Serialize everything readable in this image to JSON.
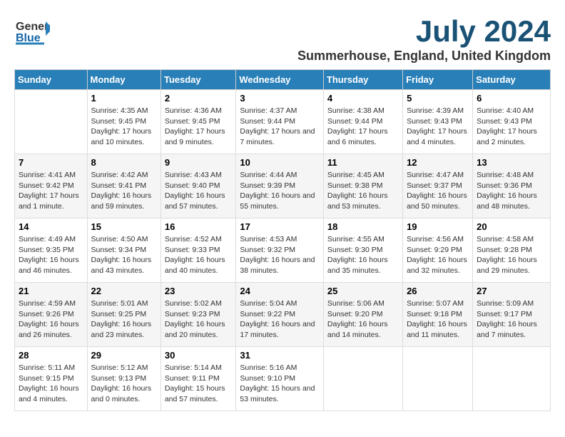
{
  "header": {
    "logo_general": "General",
    "logo_blue": "Blue",
    "title": "July 2024",
    "subtitle": "Summerhouse, England, United Kingdom"
  },
  "calendar": {
    "days": [
      "Sunday",
      "Monday",
      "Tuesday",
      "Wednesday",
      "Thursday",
      "Friday",
      "Saturday"
    ],
    "weeks": [
      [
        {
          "date": "",
          "content": ""
        },
        {
          "date": "1",
          "content": "Sunrise: 4:35 AM\nSunset: 9:45 PM\nDaylight: 17 hours\nand 10 minutes."
        },
        {
          "date": "2",
          "content": "Sunrise: 4:36 AM\nSunset: 9:45 PM\nDaylight: 17 hours\nand 9 minutes."
        },
        {
          "date": "3",
          "content": "Sunrise: 4:37 AM\nSunset: 9:44 PM\nDaylight: 17 hours\nand 7 minutes."
        },
        {
          "date": "4",
          "content": "Sunrise: 4:38 AM\nSunset: 9:44 PM\nDaylight: 17 hours\nand 6 minutes."
        },
        {
          "date": "5",
          "content": "Sunrise: 4:39 AM\nSunset: 9:43 PM\nDaylight: 17 hours\nand 4 minutes."
        },
        {
          "date": "6",
          "content": "Sunrise: 4:40 AM\nSunset: 9:43 PM\nDaylight: 17 hours\nand 2 minutes."
        }
      ],
      [
        {
          "date": "7",
          "content": "Sunrise: 4:41 AM\nSunset: 9:42 PM\nDaylight: 17 hours\nand 1 minute."
        },
        {
          "date": "8",
          "content": "Sunrise: 4:42 AM\nSunset: 9:41 PM\nDaylight: 16 hours\nand 59 minutes."
        },
        {
          "date": "9",
          "content": "Sunrise: 4:43 AM\nSunset: 9:40 PM\nDaylight: 16 hours\nand 57 minutes."
        },
        {
          "date": "10",
          "content": "Sunrise: 4:44 AM\nSunset: 9:39 PM\nDaylight: 16 hours\nand 55 minutes."
        },
        {
          "date": "11",
          "content": "Sunrise: 4:45 AM\nSunset: 9:38 PM\nDaylight: 16 hours\nand 53 minutes."
        },
        {
          "date": "12",
          "content": "Sunrise: 4:47 AM\nSunset: 9:37 PM\nDaylight: 16 hours\nand 50 minutes."
        },
        {
          "date": "13",
          "content": "Sunrise: 4:48 AM\nSunset: 9:36 PM\nDaylight: 16 hours\nand 48 minutes."
        }
      ],
      [
        {
          "date": "14",
          "content": "Sunrise: 4:49 AM\nSunset: 9:35 PM\nDaylight: 16 hours\nand 46 minutes."
        },
        {
          "date": "15",
          "content": "Sunrise: 4:50 AM\nSunset: 9:34 PM\nDaylight: 16 hours\nand 43 minutes."
        },
        {
          "date": "16",
          "content": "Sunrise: 4:52 AM\nSunset: 9:33 PM\nDaylight: 16 hours\nand 40 minutes."
        },
        {
          "date": "17",
          "content": "Sunrise: 4:53 AM\nSunset: 9:32 PM\nDaylight: 16 hours\nand 38 minutes."
        },
        {
          "date": "18",
          "content": "Sunrise: 4:55 AM\nSunset: 9:30 PM\nDaylight: 16 hours\nand 35 minutes."
        },
        {
          "date": "19",
          "content": "Sunrise: 4:56 AM\nSunset: 9:29 PM\nDaylight: 16 hours\nand 32 minutes."
        },
        {
          "date": "20",
          "content": "Sunrise: 4:58 AM\nSunset: 9:28 PM\nDaylight: 16 hours\nand 29 minutes."
        }
      ],
      [
        {
          "date": "21",
          "content": "Sunrise: 4:59 AM\nSunset: 9:26 PM\nDaylight: 16 hours\nand 26 minutes."
        },
        {
          "date": "22",
          "content": "Sunrise: 5:01 AM\nSunset: 9:25 PM\nDaylight: 16 hours\nand 23 minutes."
        },
        {
          "date": "23",
          "content": "Sunrise: 5:02 AM\nSunset: 9:23 PM\nDaylight: 16 hours\nand 20 minutes."
        },
        {
          "date": "24",
          "content": "Sunrise: 5:04 AM\nSunset: 9:22 PM\nDaylight: 16 hours\nand 17 minutes."
        },
        {
          "date": "25",
          "content": "Sunrise: 5:06 AM\nSunset: 9:20 PM\nDaylight: 16 hours\nand 14 minutes."
        },
        {
          "date": "26",
          "content": "Sunrise: 5:07 AM\nSunset: 9:18 PM\nDaylight: 16 hours\nand 11 minutes."
        },
        {
          "date": "27",
          "content": "Sunrise: 5:09 AM\nSunset: 9:17 PM\nDaylight: 16 hours\nand 7 minutes."
        }
      ],
      [
        {
          "date": "28",
          "content": "Sunrise: 5:11 AM\nSunset: 9:15 PM\nDaylight: 16 hours\nand 4 minutes."
        },
        {
          "date": "29",
          "content": "Sunrise: 5:12 AM\nSunset: 9:13 PM\nDaylight: 16 hours\nand 0 minutes."
        },
        {
          "date": "30",
          "content": "Sunrise: 5:14 AM\nSunset: 9:11 PM\nDaylight: 15 hours\nand 57 minutes."
        },
        {
          "date": "31",
          "content": "Sunrise: 5:16 AM\nSunset: 9:10 PM\nDaylight: 15 hours\nand 53 minutes."
        },
        {
          "date": "",
          "content": ""
        },
        {
          "date": "",
          "content": ""
        },
        {
          "date": "",
          "content": ""
        }
      ]
    ]
  }
}
